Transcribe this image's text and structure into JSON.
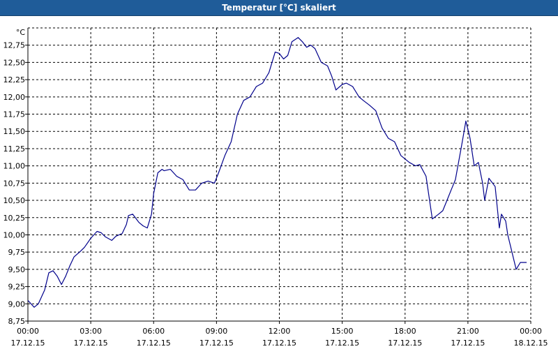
{
  "window": {
    "title": "Temperatur [°C] skaliert"
  },
  "chart_data": {
    "type": "line",
    "title": "Temperatur [°C] skaliert",
    "y_unit": "°C",
    "xlabel": "",
    "ylabel": "",
    "ylim": [
      8.75,
      13.0
    ],
    "yticks": [
      8.75,
      9.0,
      9.25,
      9.5,
      9.75,
      10.0,
      10.25,
      10.5,
      10.75,
      11.0,
      11.25,
      11.5,
      11.75,
      12.0,
      12.25,
      12.5,
      12.75
    ],
    "ytick_labels": [
      "8,75",
      "9,00",
      "9,25",
      "9,50",
      "9,75",
      "10,00",
      "10,25",
      "10,50",
      "10,75",
      "11,00",
      "11,25",
      "11,50",
      "11,75",
      "12,00",
      "12,25",
      "12,50",
      "12,75"
    ],
    "xlim": [
      0,
      24
    ],
    "xticks": [
      0,
      3,
      6,
      9,
      12,
      15,
      18,
      21,
      24
    ],
    "xtick_time_labels": [
      "00:00",
      "03:00",
      "06:00",
      "09:00",
      "12:00",
      "15:00",
      "18:00",
      "21:00",
      "00:00"
    ],
    "xtick_date_labels": [
      "17.12.15",
      "17.12.15",
      "17.12.15",
      "17.12.15",
      "17.12.15",
      "17.12.15",
      "17.12.15",
      "17.12.15",
      "18.12.15"
    ],
    "grid": true,
    "line_color": "#00008b",
    "series": [
      {
        "x": [
          0.0,
          0.3,
          0.5,
          0.8,
          1.0,
          1.2,
          1.4,
          1.6,
          1.8,
          2.0,
          2.2,
          2.5,
          2.7,
          3.0,
          3.3,
          3.5,
          3.7,
          4.0,
          4.2,
          4.5,
          4.7,
          4.8,
          5.0,
          5.2,
          5.3,
          5.5,
          5.7,
          5.9,
          6.0,
          6.2,
          6.4,
          6.5,
          6.8,
          7.1,
          7.4,
          7.7,
          8.0,
          8.3,
          8.6,
          8.9,
          9.1,
          9.4,
          9.7,
          10.0,
          10.3,
          10.6,
          10.9,
          11.2,
          11.5,
          11.8,
          12.0,
          12.2,
          12.4,
          12.6,
          12.9,
          13.1,
          13.3,
          13.5,
          13.7,
          14.0,
          14.3,
          14.5,
          14.7,
          15.0,
          15.2,
          15.5,
          15.8,
          16.0,
          16.3,
          16.6,
          16.9,
          17.2,
          17.5,
          17.8,
          18.0,
          18.2,
          18.5,
          18.7,
          19.0,
          19.3,
          19.6,
          19.8,
          20.0,
          20.2,
          20.4,
          20.7,
          20.9,
          21.1,
          21.3,
          21.5,
          21.7,
          21.8,
          22.0,
          22.3,
          22.5,
          22.6,
          22.8,
          22.9,
          23.1,
          23.3,
          23.5,
          23.7,
          23.8
        ],
        "y": [
          9.05,
          8.95,
          9.0,
          9.2,
          9.45,
          9.48,
          9.4,
          9.28,
          9.4,
          9.55,
          9.68,
          9.76,
          9.82,
          9.95,
          10.05,
          10.03,
          9.97,
          9.92,
          9.98,
          10.02,
          10.15,
          10.28,
          10.3,
          10.22,
          10.18,
          10.13,
          10.1,
          10.3,
          10.6,
          10.9,
          10.95,
          10.93,
          10.95,
          10.85,
          10.8,
          10.65,
          10.65,
          10.75,
          10.78,
          10.75,
          10.9,
          11.15,
          11.35,
          11.75,
          11.95,
          12.0,
          12.15,
          12.2,
          12.35,
          12.65,
          12.63,
          12.55,
          12.6,
          12.8,
          12.86,
          12.8,
          12.72,
          12.75,
          12.7,
          12.5,
          12.45,
          12.3,
          12.1,
          12.18,
          12.2,
          12.15,
          12.0,
          11.95,
          11.88,
          11.8,
          11.55,
          11.4,
          11.35,
          11.15,
          11.1,
          11.05,
          11.0,
          11.02,
          10.85,
          10.23,
          10.3,
          10.35,
          10.5,
          10.65,
          10.8,
          11.3,
          11.65,
          11.4,
          11.0,
          11.05,
          10.75,
          10.5,
          10.82,
          10.7,
          10.1,
          10.3,
          10.2,
          10.0,
          9.75,
          9.5,
          9.6,
          9.6,
          9.6
        ]
      }
    ]
  }
}
